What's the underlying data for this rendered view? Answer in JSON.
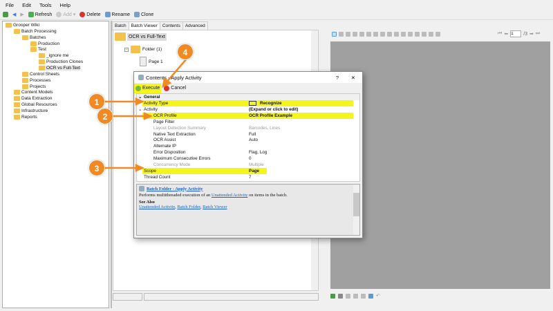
{
  "menu": [
    "File",
    "Edit",
    "Tools",
    "Help"
  ],
  "toolbar": {
    "refresh": "Refresh",
    "add": "Add",
    "delete": "Delete",
    "rename": "Rename",
    "clone": "Clone"
  },
  "tree": [
    {
      "label": "Grooper Wiki",
      "level": 0
    },
    {
      "label": "Batch Processing",
      "level": 1
    },
    {
      "label": "Batches",
      "level": 2
    },
    {
      "label": "Production",
      "level": 3
    },
    {
      "label": "Test",
      "level": 3
    },
    {
      "label": "_ignore me",
      "level": 4
    },
    {
      "label": "Production Clones",
      "level": 4
    },
    {
      "label": "OCR vs Full-Text",
      "level": 4
    },
    {
      "label": "Control Sheets",
      "level": 2
    },
    {
      "label": "Processes",
      "level": 2
    },
    {
      "label": "Projects",
      "level": 2
    },
    {
      "label": "Content Models",
      "level": 1
    },
    {
      "label": "Data Extraction",
      "level": 1
    },
    {
      "label": "Global Resources",
      "level": 1
    },
    {
      "label": "Infrastructure",
      "level": 1
    },
    {
      "label": "Reports",
      "level": 1
    }
  ],
  "tabs": [
    "Batch",
    "Batch Viewer",
    "Contents",
    "Advanced"
  ],
  "batch_viewer": {
    "root": "OCR vs Full-Text",
    "folder": "Folder (1)",
    "page": "Page 1"
  },
  "viewer": {
    "page_input": "1",
    "page_total": "/3"
  },
  "dialog": {
    "title": "Contents - Apply Activity",
    "help": "?",
    "close": "✕",
    "execute": "Execute",
    "cancel": "Cancel",
    "general": "General",
    "rows": [
      {
        "key": "Activity Type",
        "value": "Recognize"
      },
      {
        "key": "Activity",
        "value": "(Expand or click to edit)"
      },
      {
        "key": "OCR Profile",
        "value": "OCR Profile Example"
      },
      {
        "key": "Page Filter",
        "value": ""
      },
      {
        "key": "Layout Detection Summary",
        "value": "Barcodes, Lines"
      },
      {
        "key": "Native Text Extraction",
        "value": "Full"
      },
      {
        "key": "OCR Assist",
        "value": "Auto"
      },
      {
        "key": "Alternate IP",
        "value": ""
      },
      {
        "key": "Error Disposition",
        "value": "Flag, Log"
      },
      {
        "key": "Maximum Consecutive Errors",
        "value": "0"
      },
      {
        "key": "Concurrency Mode",
        "value": "Multiple"
      },
      {
        "key": "Scope",
        "value": "Page"
      },
      {
        "key": "Thread Count",
        "value": "7"
      }
    ],
    "help_pane": {
      "title": "Batch Folder - Apply Activity",
      "text_pre": "Performs multithreaded execution of an",
      "text_link": "Unattended Activity",
      "text_post": "on items in the batch.",
      "see_also": "See Also",
      "links": [
        "Unattended Activity",
        "Batch Folder",
        "Batch Viewer"
      ]
    }
  },
  "callouts": [
    "1",
    "2",
    "3",
    "4"
  ],
  "colors": {
    "highlight": "#f5f51e",
    "callout": "#f08a24",
    "link": "#1a5fc8"
  }
}
